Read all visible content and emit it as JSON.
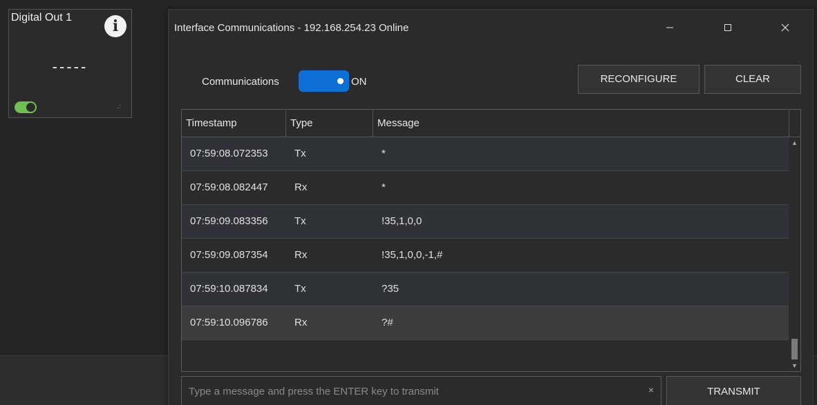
{
  "widget": {
    "title": "Digital Out 1",
    "value": "-----",
    "info_icon": "info-icon",
    "toggle_color": "#6fbf52"
  },
  "dialog": {
    "title": "Interface Communications - 192.168.254.23 Online",
    "window_controls": {
      "minimize": "—",
      "maximize": "☐",
      "close": "✕"
    },
    "communications_label": "Communications",
    "toggle_state": "ON",
    "toggle_color": "#0e6fd6",
    "reconfigure_label": "RECONFIGURE",
    "clear_label": "CLEAR",
    "table": {
      "columns": [
        "Timestamp",
        "Type",
        "Message"
      ],
      "rows": [
        {
          "timestamp": "07:59:08.072353",
          "type": "Tx",
          "message": "*"
        },
        {
          "timestamp": "07:59:08.082447",
          "type": "Rx",
          "message": "*"
        },
        {
          "timestamp": "07:59:09.083356",
          "type": "Tx",
          "message": "!35,1,0,0"
        },
        {
          "timestamp": "07:59:09.087354",
          "type": "Rx",
          "message": "!35,1,0,0,-1,#"
        },
        {
          "timestamp": "07:59:10.087834",
          "type": "Tx",
          "message": "?35"
        },
        {
          "timestamp": "07:59:10.096786",
          "type": "Rx",
          "message": "?#"
        }
      ]
    },
    "input": {
      "value": "",
      "placeholder": "Type a message and press the ENTER key to transmit",
      "clear_glyph": "×"
    },
    "transmit_label": "TRANSMIT"
  }
}
